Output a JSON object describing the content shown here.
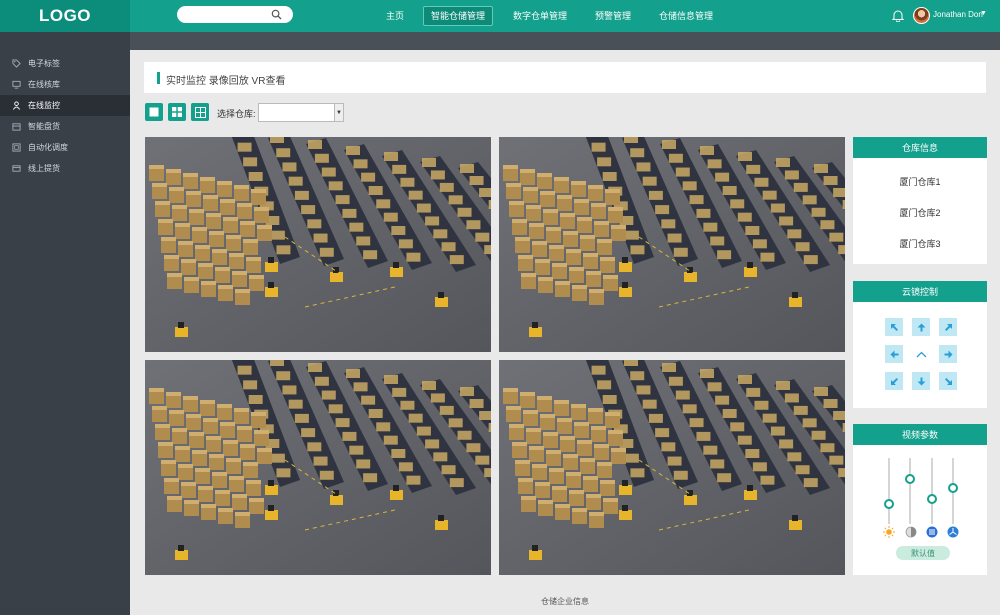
{
  "header": {
    "logo": "LOGO",
    "search_placeholder": "",
    "nav": [
      "主页",
      "智能仓储管理",
      "数字仓单管理",
      "预警管理",
      "仓储信息管理"
    ],
    "active_nav_index": 1,
    "username": "Jonathan Don",
    "accent_color": "#13a08c"
  },
  "sidebar": {
    "items": [
      {
        "label": "电子标签",
        "icon": "tag-icon"
      },
      {
        "label": "在线核库",
        "icon": "monitor-icon"
      },
      {
        "label": "在线监控",
        "icon": "people-icon"
      },
      {
        "label": "智能盘货",
        "icon": "box-icon"
      },
      {
        "label": "自动化调度",
        "icon": "schedule-icon"
      },
      {
        "label": "线上提货",
        "icon": "card-icon"
      }
    ],
    "active_index": 2
  },
  "breadcrumb": {
    "text": "实时监控 录像回放 VR查看"
  },
  "toolbar": {
    "select_label": "选择仓库:",
    "select_value": ""
  },
  "warehouse_panel": {
    "title": "仓库信息",
    "items": [
      "厦门仓库1",
      "厦门仓库2",
      "厦门仓库3"
    ]
  },
  "ptz_panel": {
    "title": "云镜控制"
  },
  "video_panel": {
    "title": "视频参数",
    "default_label": "默认值",
    "sliders": [
      {
        "name": "brightness",
        "icon": "sun-icon",
        "value": 0.3
      },
      {
        "name": "contrast",
        "icon": "contrast-icon",
        "value": 0.68
      },
      {
        "name": "saturation",
        "icon": "saturation-icon",
        "value": 0.38
      },
      {
        "name": "hue",
        "icon": "hue-icon",
        "value": 0.55
      }
    ]
  },
  "footer": {
    "text": "仓储企业信息"
  }
}
